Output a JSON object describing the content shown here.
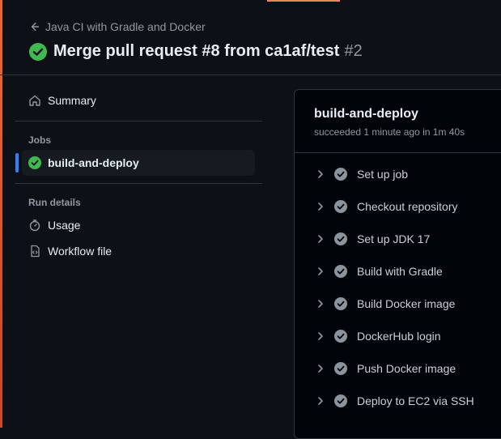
{
  "header": {
    "back_label": "Java CI with Gradle and Docker",
    "title": "Merge pull request #8 from ca1af/test",
    "run_number": "#2"
  },
  "sidebar": {
    "summary_label": "Summary",
    "jobs_section": "Jobs",
    "job_name": "build-and-deploy",
    "run_details_section": "Run details",
    "usage_label": "Usage",
    "workflow_file_label": "Workflow file"
  },
  "job": {
    "title": "build-and-deploy",
    "status_text": "succeeded 1 minute ago in 1m 40s",
    "steps": [
      "Set up job",
      "Checkout repository",
      "Set up JDK 17",
      "Build with Gradle",
      "Build Docker image",
      "DockerHub login",
      "Push Docker image",
      "Deploy to EC2 via SSH"
    ]
  },
  "colors": {
    "success": "#3fb950",
    "accent_blue": "#2f81f7",
    "background": "#0d1117"
  }
}
